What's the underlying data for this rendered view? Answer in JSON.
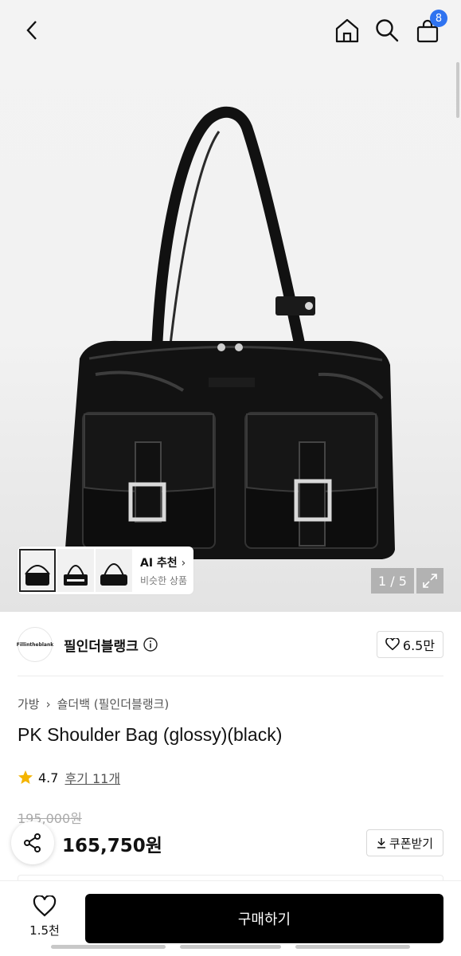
{
  "header": {
    "back_icon": "chevron-left-icon",
    "home_icon": "home-icon",
    "search_icon": "search-icon",
    "cart_icon": "shopping-bag-icon",
    "cart_badge": "8"
  },
  "gallery": {
    "image": "black glossy leather shoulder bag",
    "brand_on_bag": "Fillintheblank",
    "pager": "1 / 5",
    "expand_icon": "expand-icon",
    "ai_recommend": {
      "title": "AI 추천",
      "subtitle": "비슷한 상품",
      "thumbnails": [
        "thumb-1",
        "thumb-2",
        "thumb-3"
      ]
    }
  },
  "brand": {
    "logo_text": "Fillintheblank",
    "name": "필인더블랭크",
    "likes": "6.5만"
  },
  "breadcrumb": [
    "가방",
    "숄더백 (필인더블랭크)"
  ],
  "product": {
    "title": "PK Shoulder Bag (glossy)(black)",
    "rating": "4.7",
    "reviews": "후기 11개",
    "original_price": "195,000원",
    "sale_price": "165,750원",
    "coupon": "쿠폰받기"
  },
  "bottom_bar": {
    "wish_count": "1.5천",
    "buy_label": "구매하기"
  },
  "colors": {
    "accent_badge": "#2f73f0",
    "star": "#f4b400",
    "buy_button": "#000000"
  }
}
